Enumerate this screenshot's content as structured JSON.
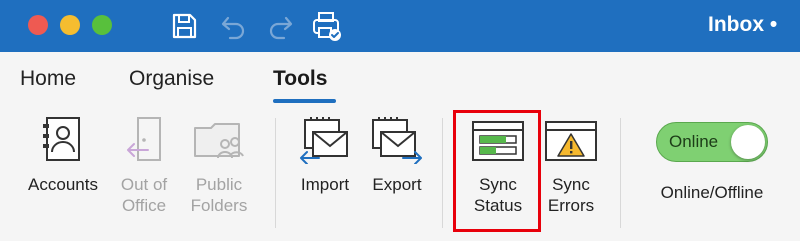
{
  "window": {
    "title": "Inbox • ",
    "accent_color": "#1f6fbf",
    "titlebar_icons": [
      "save-icon",
      "undo-icon",
      "redo-icon",
      "send-receive-icon"
    ]
  },
  "tabs": [
    {
      "label": "Home",
      "active": false
    },
    {
      "label": "Organise",
      "active": false
    },
    {
      "label": "Tools",
      "active": true
    }
  ],
  "ribbon": {
    "accounts": {
      "label": "Accounts",
      "icon": "accounts-icon",
      "enabled": true
    },
    "out_of_office": {
      "line1": "Out of",
      "line2": "Office",
      "icon": "out-of-office-icon",
      "enabled": false
    },
    "public_folders": {
      "line1": "Public",
      "line2": "Folders",
      "icon": "public-folders-icon",
      "enabled": false
    },
    "import": {
      "label": "Import",
      "icon": "import-icon",
      "enabled": true
    },
    "export": {
      "label": "Export",
      "icon": "export-icon",
      "enabled": true
    },
    "sync_status": {
      "line1": "Sync",
      "line2": "Status",
      "icon": "sync-status-icon",
      "highlighted": true
    },
    "sync_errors": {
      "line1": "Sync",
      "line2": "Errors",
      "icon": "sync-errors-icon"
    },
    "online_offline": {
      "toggle_text": "Online",
      "state": "on",
      "label": "Online/Offline",
      "toggle_color": "#7fd072"
    }
  },
  "highlight_color": "#e8000b"
}
